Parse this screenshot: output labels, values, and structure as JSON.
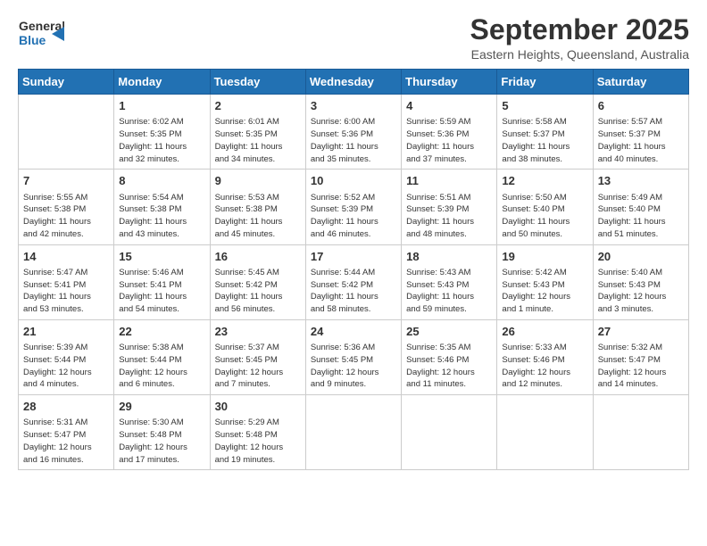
{
  "header": {
    "logo_line1": "General",
    "logo_line2": "Blue",
    "month": "September 2025",
    "location": "Eastern Heights, Queensland, Australia"
  },
  "days_of_week": [
    "Sunday",
    "Monday",
    "Tuesday",
    "Wednesday",
    "Thursday",
    "Friday",
    "Saturday"
  ],
  "weeks": [
    [
      {
        "day": "",
        "info": ""
      },
      {
        "day": "1",
        "info": "Sunrise: 6:02 AM\nSunset: 5:35 PM\nDaylight: 11 hours\nand 32 minutes."
      },
      {
        "day": "2",
        "info": "Sunrise: 6:01 AM\nSunset: 5:35 PM\nDaylight: 11 hours\nand 34 minutes."
      },
      {
        "day": "3",
        "info": "Sunrise: 6:00 AM\nSunset: 5:36 PM\nDaylight: 11 hours\nand 35 minutes."
      },
      {
        "day": "4",
        "info": "Sunrise: 5:59 AM\nSunset: 5:36 PM\nDaylight: 11 hours\nand 37 minutes."
      },
      {
        "day": "5",
        "info": "Sunrise: 5:58 AM\nSunset: 5:37 PM\nDaylight: 11 hours\nand 38 minutes."
      },
      {
        "day": "6",
        "info": "Sunrise: 5:57 AM\nSunset: 5:37 PM\nDaylight: 11 hours\nand 40 minutes."
      }
    ],
    [
      {
        "day": "7",
        "info": "Sunrise: 5:55 AM\nSunset: 5:38 PM\nDaylight: 11 hours\nand 42 minutes."
      },
      {
        "day": "8",
        "info": "Sunrise: 5:54 AM\nSunset: 5:38 PM\nDaylight: 11 hours\nand 43 minutes."
      },
      {
        "day": "9",
        "info": "Sunrise: 5:53 AM\nSunset: 5:38 PM\nDaylight: 11 hours\nand 45 minutes."
      },
      {
        "day": "10",
        "info": "Sunrise: 5:52 AM\nSunset: 5:39 PM\nDaylight: 11 hours\nand 46 minutes."
      },
      {
        "day": "11",
        "info": "Sunrise: 5:51 AM\nSunset: 5:39 PM\nDaylight: 11 hours\nand 48 minutes."
      },
      {
        "day": "12",
        "info": "Sunrise: 5:50 AM\nSunset: 5:40 PM\nDaylight: 11 hours\nand 50 minutes."
      },
      {
        "day": "13",
        "info": "Sunrise: 5:49 AM\nSunset: 5:40 PM\nDaylight: 11 hours\nand 51 minutes."
      }
    ],
    [
      {
        "day": "14",
        "info": "Sunrise: 5:47 AM\nSunset: 5:41 PM\nDaylight: 11 hours\nand 53 minutes."
      },
      {
        "day": "15",
        "info": "Sunrise: 5:46 AM\nSunset: 5:41 PM\nDaylight: 11 hours\nand 54 minutes."
      },
      {
        "day": "16",
        "info": "Sunrise: 5:45 AM\nSunset: 5:42 PM\nDaylight: 11 hours\nand 56 minutes."
      },
      {
        "day": "17",
        "info": "Sunrise: 5:44 AM\nSunset: 5:42 PM\nDaylight: 11 hours\nand 58 minutes."
      },
      {
        "day": "18",
        "info": "Sunrise: 5:43 AM\nSunset: 5:43 PM\nDaylight: 11 hours\nand 59 minutes."
      },
      {
        "day": "19",
        "info": "Sunrise: 5:42 AM\nSunset: 5:43 PM\nDaylight: 12 hours\nand 1 minute."
      },
      {
        "day": "20",
        "info": "Sunrise: 5:40 AM\nSunset: 5:43 PM\nDaylight: 12 hours\nand 3 minutes."
      }
    ],
    [
      {
        "day": "21",
        "info": "Sunrise: 5:39 AM\nSunset: 5:44 PM\nDaylight: 12 hours\nand 4 minutes."
      },
      {
        "day": "22",
        "info": "Sunrise: 5:38 AM\nSunset: 5:44 PM\nDaylight: 12 hours\nand 6 minutes."
      },
      {
        "day": "23",
        "info": "Sunrise: 5:37 AM\nSunset: 5:45 PM\nDaylight: 12 hours\nand 7 minutes."
      },
      {
        "day": "24",
        "info": "Sunrise: 5:36 AM\nSunset: 5:45 PM\nDaylight: 12 hours\nand 9 minutes."
      },
      {
        "day": "25",
        "info": "Sunrise: 5:35 AM\nSunset: 5:46 PM\nDaylight: 12 hours\nand 11 minutes."
      },
      {
        "day": "26",
        "info": "Sunrise: 5:33 AM\nSunset: 5:46 PM\nDaylight: 12 hours\nand 12 minutes."
      },
      {
        "day": "27",
        "info": "Sunrise: 5:32 AM\nSunset: 5:47 PM\nDaylight: 12 hours\nand 14 minutes."
      }
    ],
    [
      {
        "day": "28",
        "info": "Sunrise: 5:31 AM\nSunset: 5:47 PM\nDaylight: 12 hours\nand 16 minutes."
      },
      {
        "day": "29",
        "info": "Sunrise: 5:30 AM\nSunset: 5:48 PM\nDaylight: 12 hours\nand 17 minutes."
      },
      {
        "day": "30",
        "info": "Sunrise: 5:29 AM\nSunset: 5:48 PM\nDaylight: 12 hours\nand 19 minutes."
      },
      {
        "day": "",
        "info": ""
      },
      {
        "day": "",
        "info": ""
      },
      {
        "day": "",
        "info": ""
      },
      {
        "day": "",
        "info": ""
      }
    ]
  ]
}
